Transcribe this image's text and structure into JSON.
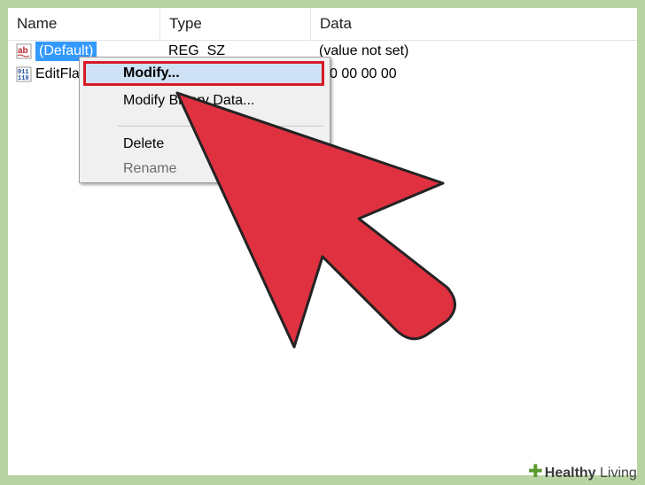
{
  "columns": {
    "name": "Name",
    "type": "Type",
    "data": "Data"
  },
  "rows": [
    {
      "name": "(Default)",
      "type": "REG_SZ",
      "data": "(value not set)",
      "icon": "string-value-icon",
      "selected": true
    },
    {
      "name": "EditFla",
      "type": "",
      "data": "0 00 00 00",
      "icon": "binary-value-icon",
      "selected": false
    }
  ],
  "context_menu": {
    "modify": "Modify...",
    "modify_binary": "Modify Binary Data...",
    "delete": "Delete",
    "rename": "Rename"
  },
  "watermark": {
    "brand_a": "Healthy",
    "brand_b": "Living"
  },
  "colors": {
    "frame": "#b9d4a3",
    "selection": "#3399ff",
    "highlight_border": "#d81a26",
    "arrow": "#e03141"
  }
}
